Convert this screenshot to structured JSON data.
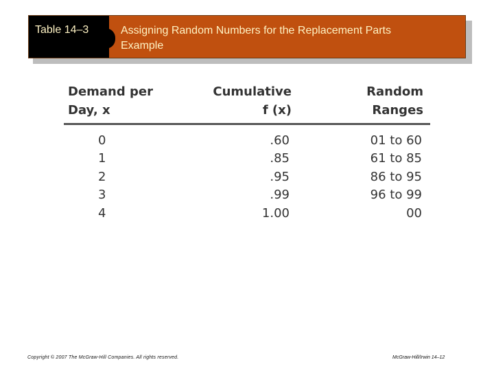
{
  "banner": {
    "label": "Table 14–3",
    "title_line1": "Assigning Random Numbers for the Replacement Parts",
    "title_line2": "Example",
    "colors": {
      "label_bg": "#000000",
      "title_bg": "#c0500f",
      "text": "#fff3c4"
    }
  },
  "table": {
    "headers": {
      "demand_line1": "Demand per",
      "demand_line2": "Day, x",
      "cumulative_line1": "Cumulative",
      "cumulative_line2": "f (x)",
      "ranges_line1": "Random",
      "ranges_line2": "Ranges"
    },
    "rows": [
      {
        "demand": "0",
        "cumulative": ".60",
        "range": "01 to 60"
      },
      {
        "demand": "1",
        "cumulative": ".85",
        "range": "61 to 85"
      },
      {
        "demand": "2",
        "cumulative": ".95",
        "range": "86 to 95"
      },
      {
        "demand": "3",
        "cumulative": ".99",
        "range": "96 to 99"
      },
      {
        "demand": "4",
        "cumulative": "1.00",
        "range": "00"
      }
    ]
  },
  "footer": {
    "copyright": "Copyright © 2007 The McGraw-Hill Companies. All rights reserved.",
    "publisher_page": "McGraw-Hill/Irwin  14–12"
  }
}
